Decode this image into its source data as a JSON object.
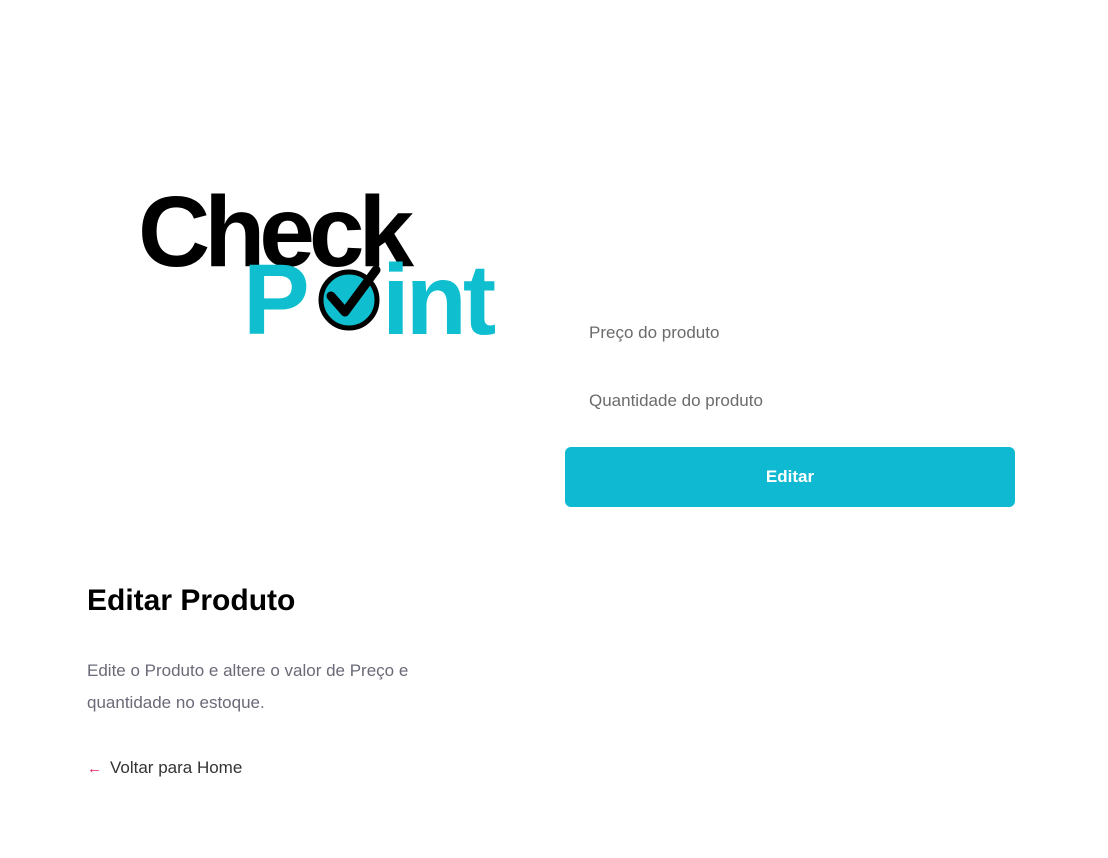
{
  "logo": {
    "word_top": "Check",
    "word_bottom_p": "P",
    "word_bottom_rest": "int",
    "colors": {
      "dark": "#000000",
      "accent": "#0fbfd0"
    },
    "icon": "check-circle-icon"
  },
  "form": {
    "price_placeholder": "Preço do produto",
    "quantity_placeholder": "Quantidade do produto",
    "submit_label": "Editar",
    "button_color": "#0fb9d1"
  },
  "content": {
    "title": "Editar Produto",
    "description": "Edite o Produto e altere o valor de Preço e quantidade no estoque.",
    "back_link_label": "Voltar para Home",
    "back_icon": "arrow-left-icon",
    "back_icon_color": "#e0245e"
  }
}
